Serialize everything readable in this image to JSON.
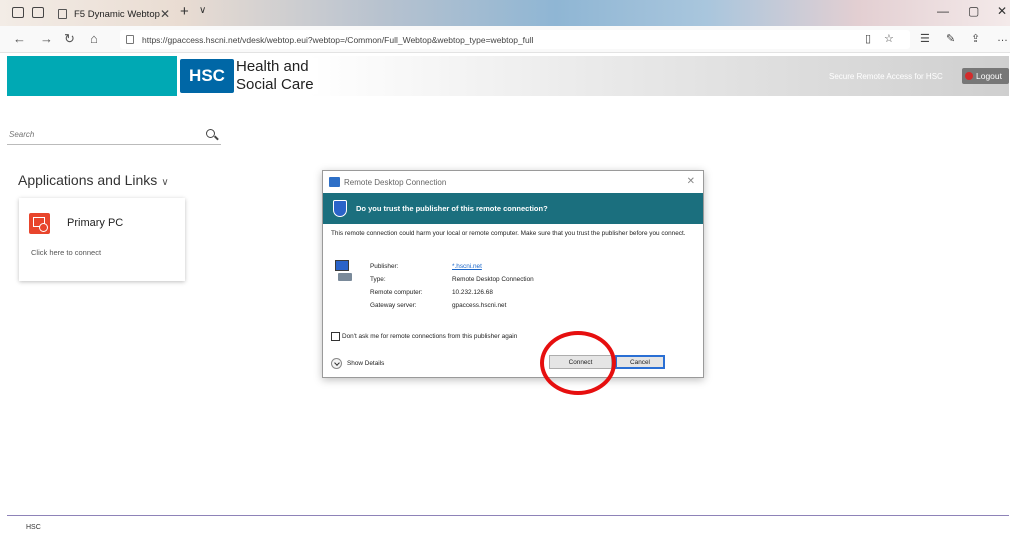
{
  "browser": {
    "tab_title": "F5 Dynamic Webtop",
    "url": "https://gpaccess.hscni.net/vdesk/webtop.eui?webtop=/Common/Full_Webtop&webtop_type=webtop_full"
  },
  "header": {
    "logo_badge": "HSC",
    "logo_name_line1": "Health and",
    "logo_name_line2": "Social Care",
    "secure_text": "Secure Remote Access for HSC",
    "logout_label": "Logout"
  },
  "search": {
    "placeholder": "Search"
  },
  "apps": {
    "section_title": "Applications and Links",
    "items": [
      {
        "name": "Primary PC",
        "link_text": "Click here to connect"
      }
    ]
  },
  "footer": {
    "text": "HSC"
  },
  "dialog": {
    "title": "Remote Desktop Connection",
    "question": "Do you trust the publisher of this remote connection?",
    "warning": "This remote connection could harm your local or remote computer. Make sure that you trust the publisher before you connect.",
    "details": [
      {
        "label": "Publisher:",
        "value": "*.hscni.net",
        "link": true
      },
      {
        "label": "Type:",
        "value": "Remote Desktop Connection",
        "link": false
      },
      {
        "label": "Remote computer:",
        "value": "10.232.126.68",
        "link": false
      },
      {
        "label": "Gateway server:",
        "value": "gpaccess.hscni.net",
        "link": false
      }
    ],
    "dont_ask_label": "Don't ask me for remote connections from this publisher again",
    "show_details_label": "Show Details",
    "connect_label": "Connect",
    "cancel_label": "Cancel"
  },
  "colors": {
    "brand_teal": "#00a9b4",
    "hsc_blue": "#0067a6",
    "dialog_banner": "#1b6f7e",
    "annotation_red": "#e60f0f"
  }
}
